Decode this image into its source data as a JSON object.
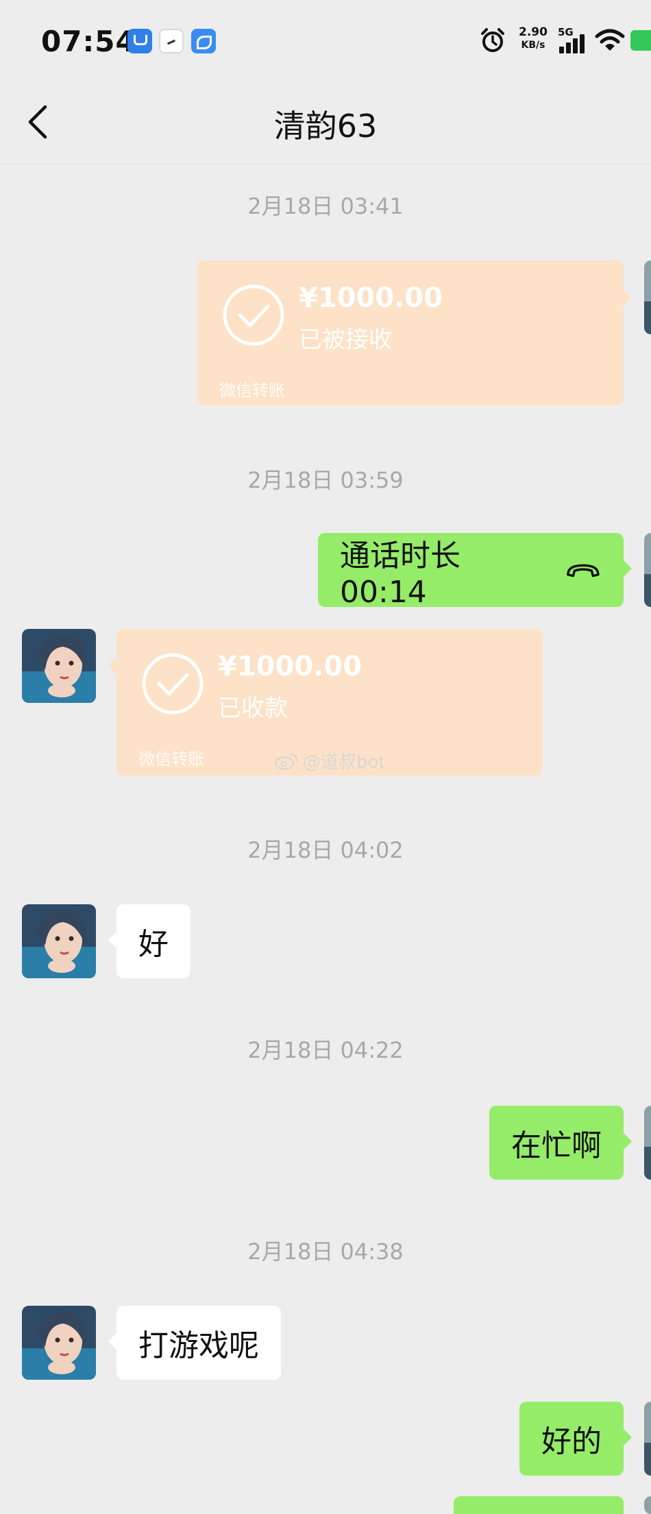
{
  "status_bar": {
    "time": "07:54",
    "net_speed_value": "2.90",
    "net_speed_unit": "KB/s",
    "network": "5G",
    "icons": [
      "notification-app-icon",
      "notification-app-icon",
      "notification-app-icon",
      "alarm-icon",
      "signal-icon",
      "wifi-icon",
      "battery-icon"
    ]
  },
  "nav": {
    "title": "清韵63",
    "back_icon": "chevron-left-icon"
  },
  "colors": {
    "background": "#ededed",
    "outgoing_bubble": "#95ec69",
    "incoming_bubble": "#ffffff",
    "transfer_card": "#fde2c7",
    "timestamp_text": "#a8a8a8"
  },
  "messages": [
    {
      "type": "timestamp",
      "text": "2月18日 03:41"
    },
    {
      "type": "transfer",
      "direction": "outgoing",
      "amount": "¥1000.00",
      "status": "已被接收",
      "label": "微信转账"
    },
    {
      "type": "timestamp",
      "text": "2月18日 03:59"
    },
    {
      "type": "call",
      "direction": "outgoing",
      "text": "通话时长 00:14"
    },
    {
      "type": "transfer",
      "direction": "incoming",
      "amount": "¥1000.00",
      "status": "已收款",
      "label": "微信转账"
    },
    {
      "type": "timestamp",
      "text": "2月18日 04:02"
    },
    {
      "type": "text",
      "direction": "incoming",
      "text": "好"
    },
    {
      "type": "timestamp",
      "text": "2月18日 04:22"
    },
    {
      "type": "text",
      "direction": "outgoing",
      "text": "在忙啊"
    },
    {
      "type": "timestamp",
      "text": "2月18日 04:38"
    },
    {
      "type": "text",
      "direction": "incoming",
      "text": "打游戏呢"
    },
    {
      "type": "text",
      "direction": "outgoing",
      "text": "好的"
    }
  ],
  "watermark": "@道叔bot"
}
